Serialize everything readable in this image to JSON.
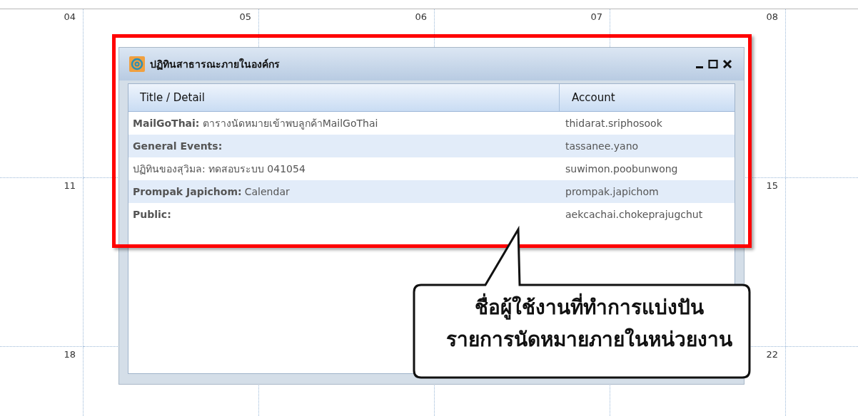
{
  "calendar": {
    "rows": [
      {
        "cells": [
          {
            "day": "04"
          },
          {
            "day": "05"
          },
          {
            "day": "06"
          },
          {
            "day": "07"
          },
          {
            "day": "08"
          }
        ]
      },
      {
        "cells": [
          {
            "day": "11"
          },
          {},
          {},
          {},
          {
            "day": "15"
          }
        ]
      },
      {
        "cells": [
          {
            "day": "18"
          },
          {},
          {},
          {},
          {
            "day": "22"
          }
        ]
      }
    ]
  },
  "window": {
    "title": "ปฏิทินสาธารณะภายในองค์กร",
    "columns": [
      "Title / Detail",
      "Account"
    ],
    "rows": [
      {
        "title": "MailGoThai:",
        "bold": true,
        "detail": "ตารางนัดหมายเข้าพบลูกค้าMailGoThai",
        "account": "thidarat.sriphosook"
      },
      {
        "title": "General Events:",
        "bold": true,
        "account": "tassanee.yano"
      },
      {
        "title": "ปฏิทินของสุวิมล:",
        "bold": false,
        "detail": "ทดสอบระบบ 041054",
        "account": "suwimon.poobunwong"
      },
      {
        "title": "Prompak Japichom:",
        "bold": true,
        "detail": "Calendar",
        "account": "prompak.japichom"
      },
      {
        "title": "Public:",
        "bold": true,
        "account": "aekcachai.chokeprajugchut"
      }
    ]
  },
  "callout": {
    "lines": [
      "ชื่อผู้ใช้งานที่ทำการแบ่งปัน",
      "รายการนัดหมายภายในหน่วยงาน"
    ]
  }
}
